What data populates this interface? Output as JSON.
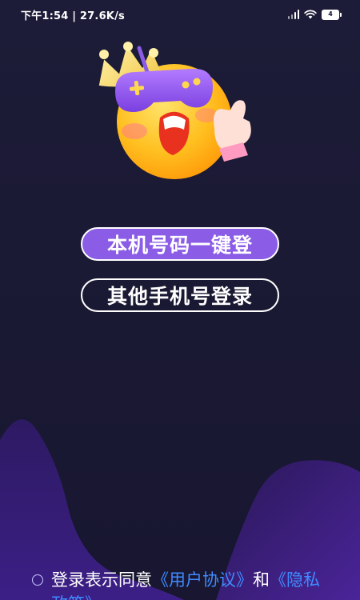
{
  "status_bar": {
    "time_speed": "下午1:54 | 27.6K/s",
    "battery_level": "4"
  },
  "actions": {
    "one_click_login": "本机号码一键登",
    "other_number_login": "其他手机号登录"
  },
  "agreement": {
    "prefix": "登录表示同意",
    "user_agreement": "《用户协议》",
    "conjunction": "和",
    "privacy_policy": "《隐私政策》"
  },
  "colors": {
    "background": "#1b1a33",
    "primary_button": "#8b5ce6",
    "link": "#3f8bff",
    "wave": "#3b1f7a"
  },
  "icons": {
    "signal": "signal-icon",
    "wifi": "wifi-icon",
    "battery": "battery-icon",
    "mascot": "mascot-gamepad-crown",
    "radio": "radio-unchecked-icon"
  }
}
